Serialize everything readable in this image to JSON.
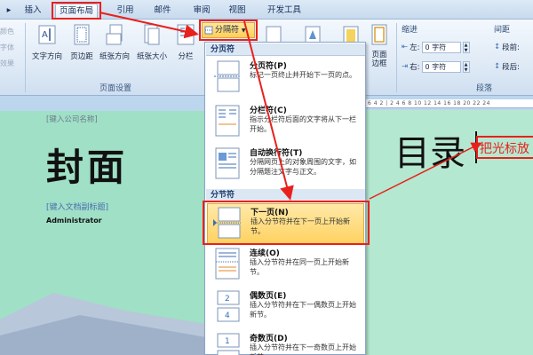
{
  "tabs": [
    "插入",
    "页面布局",
    "引用",
    "邮件",
    "审阅",
    "视图",
    "开发工具"
  ],
  "ribbon": {
    "page_setup": {
      "buttons": [
        "文字方向",
        "页边距",
        "纸张方向",
        "纸张大小",
        "分栏"
      ],
      "group_label": "页面设置"
    },
    "breaks_button": "分隔符",
    "page_border": "页面边框",
    "left_stubs": [
      "颜色",
      "字体",
      "效果"
    ],
    "paragraph": {
      "indent_label": "缩进",
      "spacing_label": "间距",
      "left_indent_label": "左:",
      "left_indent_value": "0 字符",
      "right_indent_label": "右:",
      "right_indent_value": "0 字符",
      "before_label": "段前:",
      "after_label": "段后:",
      "group_label": "段落"
    }
  },
  "menu": {
    "page_breaks_header": "分页符",
    "section_breaks_header": "分节符",
    "items": [
      {
        "name": "分页符(P)",
        "desc": "标记一页终止并开始下一页的点。"
      },
      {
        "name": "分栏符(C)",
        "desc": "指示分栏符后面的文字将从下一栏开始。"
      },
      {
        "name": "自动换行符(T)",
        "desc": "分隔网页上的对象周围的文字，如分隔题注文字与正文。"
      },
      {
        "name": "下一页(N)",
        "desc": "插入分节符并在下一页上开始新节。"
      },
      {
        "name": "连续(O)",
        "desc": "插入分节符并在同一页上开始新节。"
      },
      {
        "name": "偶数页(E)",
        "desc": "插入分节符并在下一偶数页上开始新节。"
      },
      {
        "name": "奇数页(D)",
        "desc": "插入分节符并在下一奇数页上开始新节。"
      }
    ]
  },
  "document": {
    "company_placeholder": "[键入公司名称]",
    "cover_title": "封面",
    "subtitle_placeholder": "[键入文档副标题]",
    "author": "Administrator",
    "toc_title": "目录",
    "hint_text": "把光标放"
  },
  "ruler_ticks": "6 4 2 | 2 4 6 8 10 12 14 16 18 20 22 24",
  "colors": {
    "annotation_red": "#e8211d",
    "menu_highlight": "#ffd261",
    "cover_green": "#9fe0c6"
  }
}
